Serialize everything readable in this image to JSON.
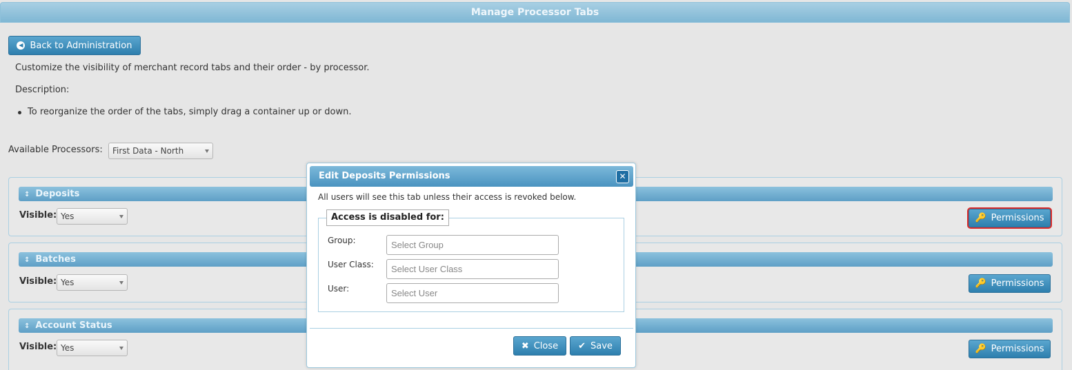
{
  "header": {
    "title": "Manage Processor Tabs"
  },
  "back_button": {
    "label": "Back to Administration",
    "icon": "circle-left-icon"
  },
  "intro": "Customize the visibility of merchant record tabs and their order - by processor.",
  "description_label": "Description:",
  "bullet": "To reorganize the order of the tabs, simply drag a container up or down.",
  "processors": {
    "label": "Available Processors:",
    "selected": "First Data - North"
  },
  "panels": [
    {
      "title": "Deposits",
      "visible_label": "Visible:",
      "visible_value": "Yes",
      "permissions_label": "Permissions"
    },
    {
      "title": "Batches",
      "visible_label": "Visible:",
      "visible_value": "Yes",
      "permissions_label": "Permissions"
    },
    {
      "title": "Account Status",
      "visible_label": "Visible:",
      "visible_value": "Yes",
      "permissions_label": "Permissions"
    }
  ],
  "dialog": {
    "title": "Edit Deposits Permissions",
    "close_icon": "✕",
    "message": "All users will see this tab unless their access is revoked below.",
    "legend": "Access is disabled for:",
    "fields": [
      {
        "label": "Group:",
        "placeholder": "Select Group"
      },
      {
        "label": "User Class:",
        "placeholder": "Select User Class"
      },
      {
        "label": "User:",
        "placeholder": "Select User"
      }
    ],
    "close_label": "Close",
    "save_label": "Save"
  },
  "colors": {
    "accent": "#2e7fae",
    "header": "#7fb7d4",
    "highlight": "#d92b2b"
  }
}
